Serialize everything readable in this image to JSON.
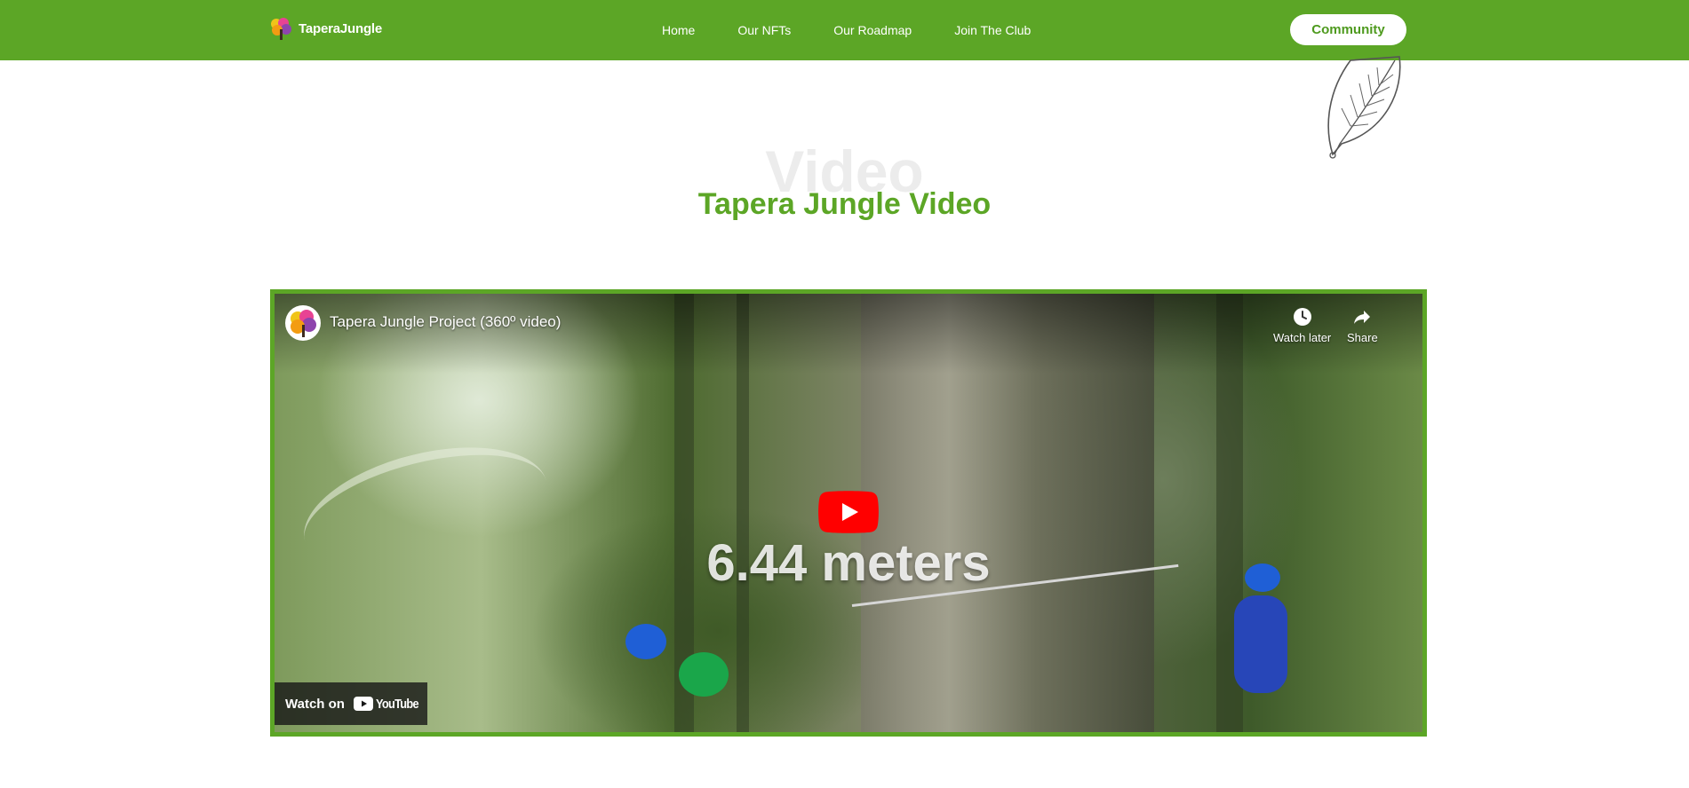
{
  "colors": {
    "brand_green": "#5ca626",
    "title_green": "#5ca626",
    "ghost_title": "#ececec",
    "youtube_red": "#ff0000",
    "white": "#ffffff"
  },
  "header": {
    "logo_text": "TaperaJungle",
    "logo_icon": "tree-logo-icon",
    "nav": [
      {
        "label": "Home"
      },
      {
        "label": "Our NFTs"
      },
      {
        "label": "Our Roadmap"
      },
      {
        "label": "Join The Club"
      }
    ],
    "cta_label": "Community"
  },
  "section": {
    "ghost_title": "Video",
    "title": "Tapera Jungle Video",
    "decoration_icon": "leaf-outline-icon"
  },
  "video": {
    "title": "Tapera Jungle Project (360º video)",
    "frame_caption": "6.44 meters",
    "watch_later_label": "Watch later",
    "share_label": "Share",
    "watch_on_label": "Watch on",
    "youtube_word": "YouTube",
    "icons": {
      "watch_later": "clock-icon",
      "share": "share-arrow-icon",
      "play": "play-button-icon",
      "youtube": "youtube-logo-icon"
    }
  }
}
